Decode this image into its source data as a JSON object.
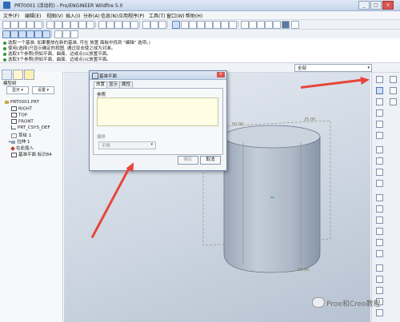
{
  "window": {
    "title": "PRT0001 (活动的) - Pro/ENGINEER Wildfire 5.0",
    "buttons": [
      "_",
      "□",
      "×"
    ]
  },
  "menubar": {
    "items": [
      "文件(F)",
      "编辑(E)",
      "视图(V)",
      "插入(I)",
      "分析(A)",
      "信息(N)",
      "应用程序(P)",
      "工具(T)",
      "窗口(W)",
      "帮助(H)"
    ]
  },
  "messages": [
    "选取一个基准, 如果要放在新的基准, 可在 放置 面板中找到 \"编辑\" 选项。)",
    "使用(选择)只显示确定的视图, 通过双击使之成为对准。",
    "选取3个参照(例如平面、曲面、边或点)以放置平面。",
    "选取3个参照(例如平面、曲面、边或点)以放置平面。"
  ],
  "filter": {
    "value": "全部"
  },
  "navigator": {
    "label": "模型树",
    "buttons": [
      "显示 ▾",
      "设置 ▾"
    ],
    "tree": [
      "PRT0001.PRT",
      "RIGHT",
      "TOP",
      "FRONT",
      "PRT_CSYS_DEF",
      "草绘 1",
      "拉伸 1",
      "在此插入",
      "基准平面 标识84"
    ]
  },
  "dialog": {
    "title": "基准平面",
    "tabs": [
      "放置",
      "显示",
      "属性"
    ],
    "references_label": "参照",
    "offset_label": "偏移",
    "translate_label": "平移",
    "confirm": "确定",
    "cancel": "取消"
  },
  "model_dims": {
    "top_left": "50.00",
    "top_right": "25.00",
    "bottom": "50.00"
  },
  "watermark": {
    "text": "Proe和Creo教程"
  },
  "colors": {
    "accent": "#2f6db5",
    "arrow": "#e8463a",
    "cylinder": "#aab4c2"
  }
}
